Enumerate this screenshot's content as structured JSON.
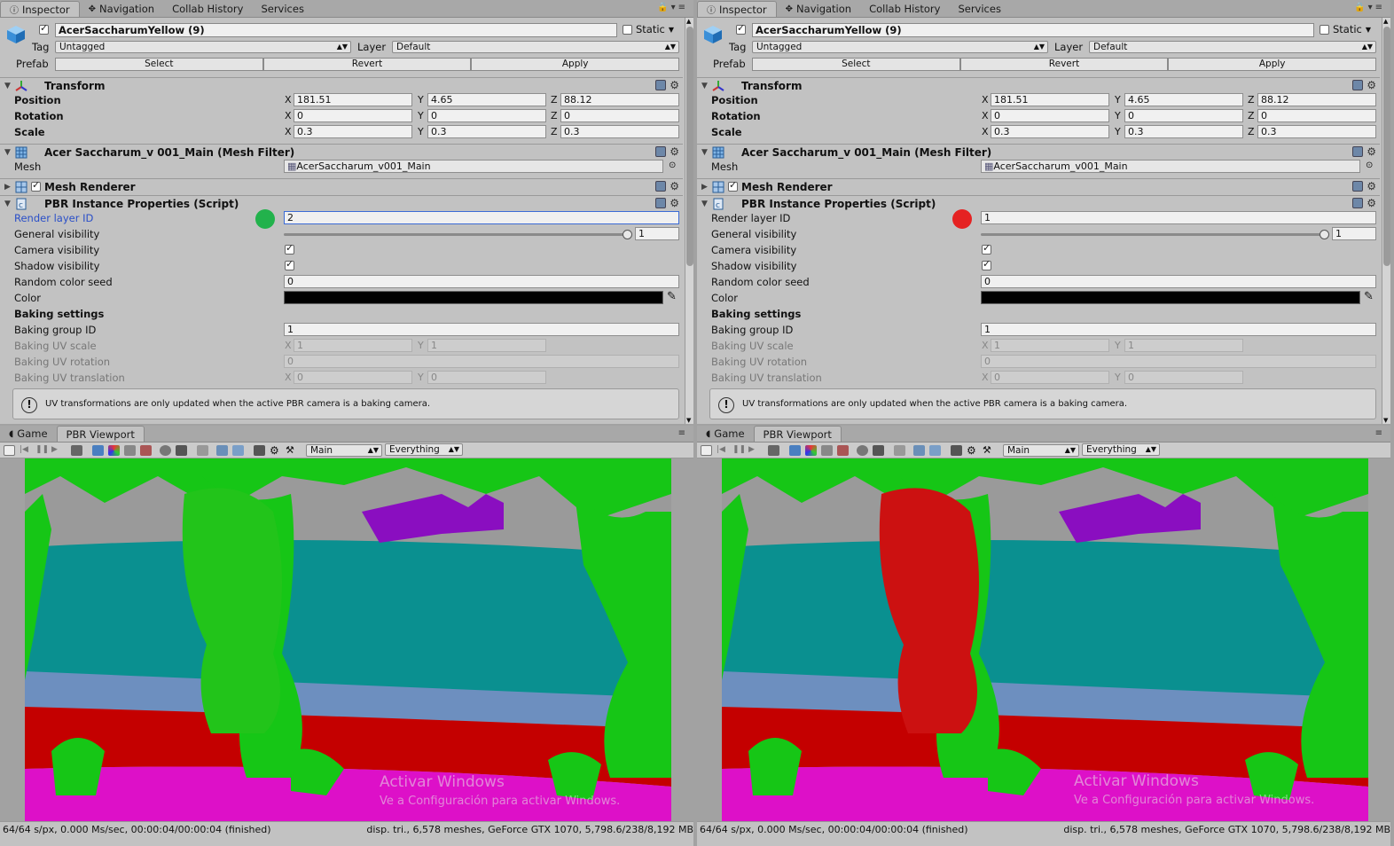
{
  "panels": [
    {
      "inspector": {
        "tabs": [
          "Inspector",
          "Navigation",
          "Collab History",
          "Services"
        ],
        "object_name": "AcerSaccharumYellow (9)",
        "static_label": "Static",
        "tag_label": "Tag",
        "tag_value": "Untagged",
        "layer_label": "Layer",
        "layer_value": "Default",
        "prefab_label": "Prefab",
        "prefab_buttons": [
          "Select",
          "Revert",
          "Apply"
        ],
        "transform": {
          "title": "Transform",
          "position_label": "Position",
          "position": [
            "181.51",
            "4.65",
            "88.12"
          ],
          "rotation_label": "Rotation",
          "rotation": [
            "0",
            "0",
            "0"
          ],
          "scale_label": "Scale",
          "scale": [
            "0.3",
            "0.3",
            "0.3"
          ]
        },
        "mesh_filter": {
          "title": "Acer Saccharum_v 001_Main (Mesh Filter)",
          "mesh_label": "Mesh",
          "mesh_value": "AcerSaccharum_v001_Main"
        },
        "mesh_renderer": {
          "title": "Mesh Renderer"
        },
        "pbr": {
          "title": "PBR Instance Properties (Script)",
          "render_layer_label": "Render layer ID",
          "render_layer_value": "2",
          "indicator_color": "#22b24c",
          "general_visibility_label": "General visibility",
          "general_visibility_value": "1",
          "camera_visibility_label": "Camera visibility",
          "shadow_visibility_label": "Shadow visibility",
          "random_seed_label": "Random color seed",
          "random_seed_value": "0",
          "color_label": "Color",
          "color_value": "#000000",
          "baking_settings_label": "Baking settings",
          "baking_group_label": "Baking group ID",
          "baking_group_value": "1",
          "uv_scale_label": "Baking UV scale",
          "uv_scale": [
            "1",
            "1"
          ],
          "uv_rotation_label": "Baking UV rotation",
          "uv_rotation_value": "0",
          "uv_translation_label": "Baking UV translation",
          "uv_translation": [
            "0",
            "0"
          ],
          "help_text": "UV transformations are only updated when the active PBR camera is a baking camera."
        }
      },
      "game": {
        "tabs": [
          "Game",
          "PBR Viewport"
        ],
        "camera_select": "Main",
        "layer_select": "Everything",
        "status_left": "64/64 s/px, 0.000 Ms/sec, 00:00:04/00:00:04 (finished)",
        "status_right": "disp. tri., 6,578 meshes, GeForce GTX 1070, 5,798.6/238/8,192 MB",
        "highlight_color": "#22c41a"
      }
    },
    {
      "inspector": {
        "tabs": [
          "Inspector",
          "Navigation",
          "Collab History",
          "Services"
        ],
        "object_name": "AcerSaccharumYellow (9)",
        "static_label": "Static",
        "tag_label": "Tag",
        "tag_value": "Untagged",
        "layer_label": "Layer",
        "layer_value": "Default",
        "prefab_label": "Prefab",
        "prefab_buttons": [
          "Select",
          "Revert",
          "Apply"
        ],
        "transform": {
          "title": "Transform",
          "position_label": "Position",
          "position": [
            "181.51",
            "4.65",
            "88.12"
          ],
          "rotation_label": "Rotation",
          "rotation": [
            "0",
            "0",
            "0"
          ],
          "scale_label": "Scale",
          "scale": [
            "0.3",
            "0.3",
            "0.3"
          ]
        },
        "mesh_filter": {
          "title": "Acer Saccharum_v 001_Main (Mesh Filter)",
          "mesh_label": "Mesh",
          "mesh_value": "AcerSaccharum_v001_Main"
        },
        "mesh_renderer": {
          "title": "Mesh Renderer"
        },
        "pbr": {
          "title": "PBR Instance Properties (Script)",
          "render_layer_label": "Render layer ID",
          "render_layer_value": "1",
          "indicator_color": "#e52222",
          "general_visibility_label": "General visibility",
          "general_visibility_value": "1",
          "camera_visibility_label": "Camera visibility",
          "shadow_visibility_label": "Shadow visibility",
          "random_seed_label": "Random color seed",
          "random_seed_value": "0",
          "color_label": "Color",
          "color_value": "#000000",
          "baking_settings_label": "Baking settings",
          "baking_group_label": "Baking group ID",
          "baking_group_value": "1",
          "uv_scale_label": "Baking UV scale",
          "uv_scale": [
            "1",
            "1"
          ],
          "uv_rotation_label": "Baking UV rotation",
          "uv_rotation_value": "0",
          "uv_translation_label": "Baking UV translation",
          "uv_translation": [
            "0",
            "0"
          ],
          "help_text": "UV transformations are only updated when the active PBR camera is a baking camera."
        }
      },
      "game": {
        "tabs": [
          "Game",
          "PBR Viewport"
        ],
        "camera_select": "Main",
        "layer_select": "Everything",
        "status_left": "64/64 s/px, 0.000 Ms/sec, 00:00:04/00:00:04 (finished)",
        "status_right": "disp. tri., 6,578 meshes, GeForce GTX 1070, 5,798.6/238/8,192 MB",
        "highlight_color": "#cc1111"
      }
    }
  ],
  "watermark": {
    "line1": "Activar Windows",
    "line2": "Ve a Configuración para activar Windows."
  }
}
